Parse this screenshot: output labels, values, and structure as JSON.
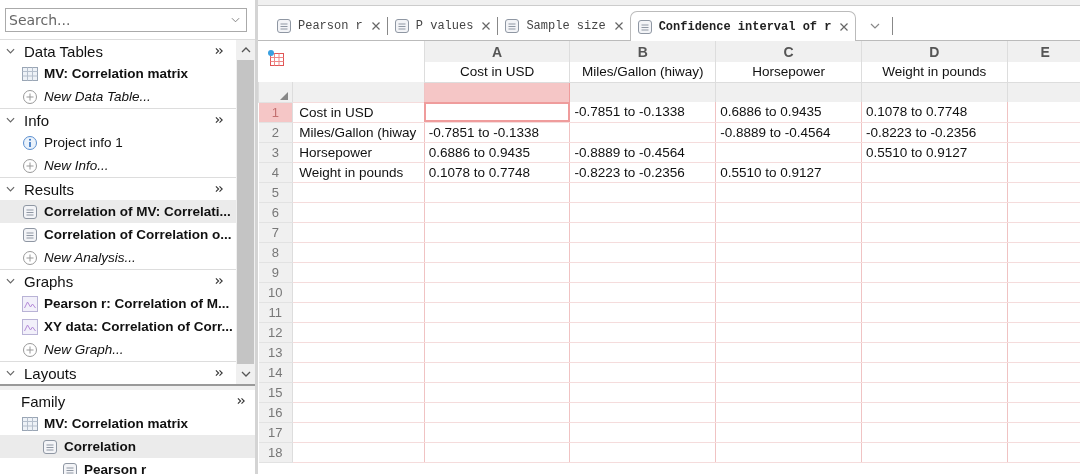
{
  "search": {
    "placeholder": "Search..."
  },
  "navigator": [
    {
      "title": "Data Tables",
      "items": [
        {
          "kind": "table",
          "label": "MV: Correlation matrix",
          "selected": false
        },
        {
          "kind": "new",
          "label": "New Data Table...",
          "selected": false
        }
      ]
    },
    {
      "title": "Info",
      "items": [
        {
          "kind": "info",
          "label": "Project info 1",
          "selected": false
        },
        {
          "kind": "new",
          "label": "New Info...",
          "selected": false
        }
      ]
    },
    {
      "title": "Results",
      "items": [
        {
          "kind": "results",
          "label": "Correlation of MV: Correlati...",
          "selected": true
        },
        {
          "kind": "results",
          "label": "Correlation of Correlation o...",
          "selected": false
        },
        {
          "kind": "new",
          "label": "New Analysis...",
          "selected": false
        }
      ]
    },
    {
      "title": "Graphs",
      "items": [
        {
          "kind": "graph",
          "label": "Pearson r: Correlation of M...",
          "selected": false
        },
        {
          "kind": "graph",
          "label": "XY data: Correlation of Corr...",
          "selected": false
        },
        {
          "kind": "new",
          "label": "New Graph...",
          "selected": false
        }
      ]
    },
    {
      "title": "Layouts"
    }
  ],
  "family": {
    "title": "Family",
    "items": [
      {
        "kind": "table",
        "label": "MV: Correlation matrix",
        "selected": false,
        "children": [
          {
            "kind": "results",
            "label": "Correlation",
            "selected": true,
            "children": [
              {
                "kind": "results",
                "label": "Pearson r",
                "selected": false
              }
            ]
          }
        ]
      }
    ]
  },
  "tabs": [
    {
      "label": "Pearson r",
      "selected": false
    },
    {
      "label": "P values",
      "selected": false
    },
    {
      "label": "Sample size",
      "selected": false
    },
    {
      "label": "Confidence interval of r",
      "selected": true
    }
  ],
  "sheet": {
    "columns": [
      {
        "letter": "A",
        "title": "Cost in USD",
        "selected": true
      },
      {
        "letter": "B",
        "title": "Miles/Gallon (hiway)",
        "selected": false
      },
      {
        "letter": "C",
        "title": "Horsepower",
        "selected": false
      },
      {
        "letter": "D",
        "title": "Weight in pounds",
        "selected": false
      },
      {
        "letter": "E",
        "selected": false
      }
    ],
    "rows": [
      {
        "number": "1",
        "title": "Cost in USD",
        "selected": true,
        "cells": [
          null,
          "-0.7851 to -0.1338",
          "0.6886 to 0.9435",
          "0.1078 to 0.7748"
        ]
      },
      {
        "number": "2",
        "title": "Miles/Gallon (hiway",
        "selected": false,
        "cells": [
          "-0.7851 to -0.1338",
          null,
          "-0.8889 to -0.4564",
          "-0.8223 to -0.2356"
        ]
      },
      {
        "number": "3",
        "title": "Horsepower",
        "selected": false,
        "cells": [
          "0.6886 to 0.9435",
          "-0.8889 to -0.4564",
          null,
          "0.5510 to 0.9127"
        ]
      },
      {
        "number": "4",
        "title": "Weight in pounds",
        "selected": false,
        "cells": [
          "0.1078 to 0.7748",
          "-0.8223 to -0.2356",
          "0.5510 to 0.9127",
          null
        ]
      },
      {
        "number": "5",
        "selected": false
      },
      {
        "number": "6",
        "selected": false
      },
      {
        "number": "7",
        "selected": false
      },
      {
        "number": "8",
        "selected": false
      },
      {
        "number": "9",
        "selected": false
      },
      {
        "number": "10",
        "selected": false
      },
      {
        "number": "11",
        "selected": false
      },
      {
        "number": "12",
        "selected": false
      },
      {
        "number": "13",
        "selected": false
      },
      {
        "number": "14",
        "selected": false
      },
      {
        "number": "15",
        "selected": false
      },
      {
        "number": "16",
        "selected": false
      },
      {
        "number": "17",
        "selected": false
      },
      {
        "number": "18",
        "selected": false
      }
    ]
  }
}
